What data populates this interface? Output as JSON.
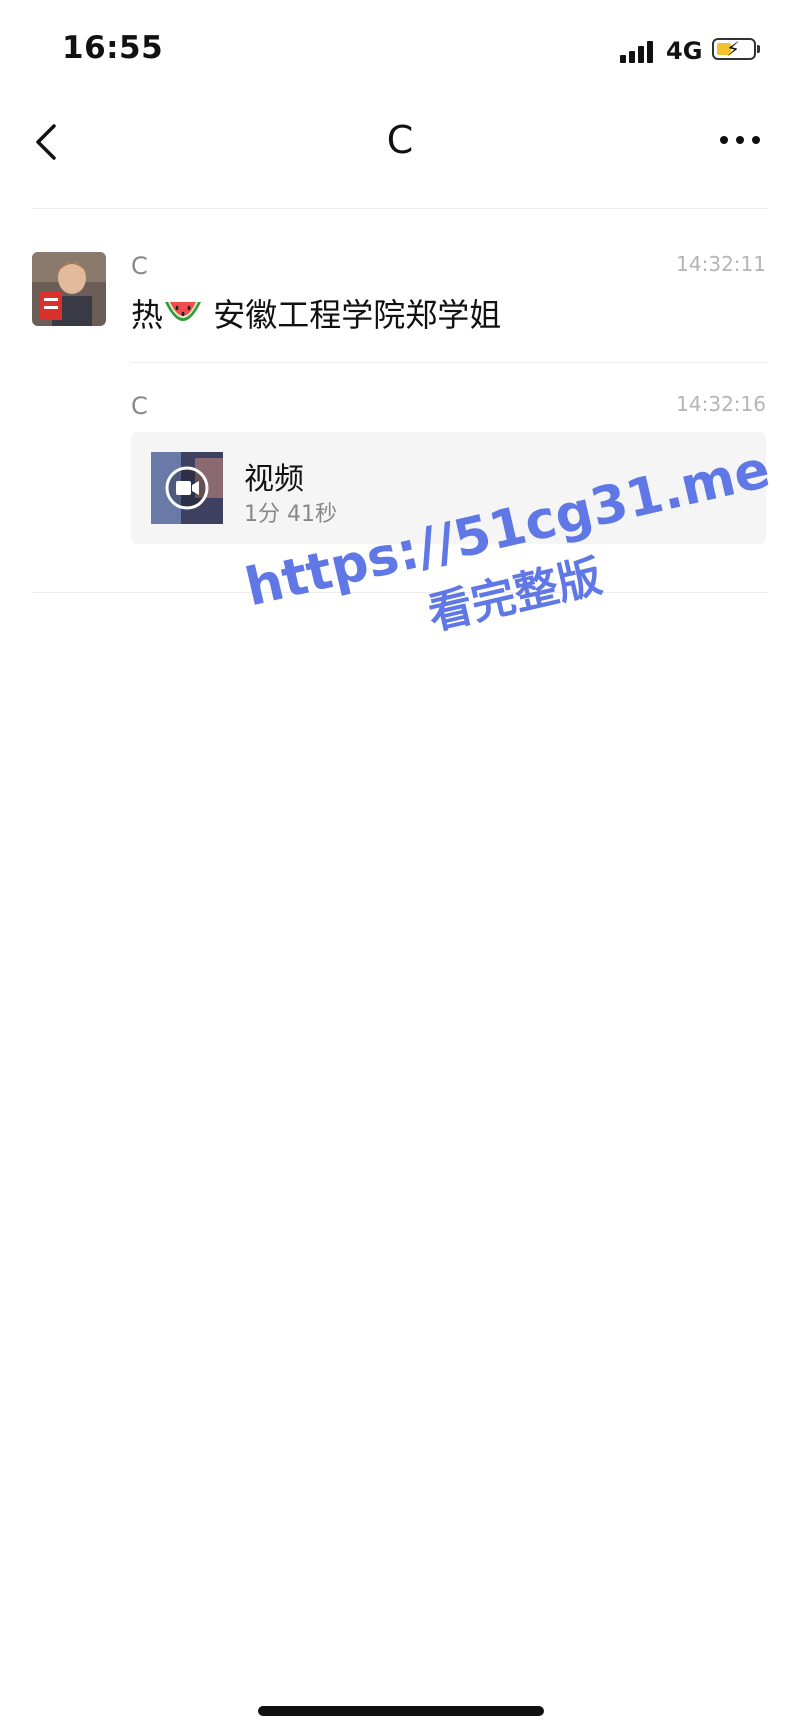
{
  "status_bar": {
    "time": "16:55",
    "network": "4G",
    "icons": [
      "signal-icon",
      "battery-charging-icon"
    ],
    "battery_color": "#f2c12e"
  },
  "nav": {
    "title": "C",
    "back_icon": "chevron-left-icon",
    "more_icon": "more-icon"
  },
  "messages": [
    {
      "sender": "C",
      "time": "14:32:11",
      "text_before": "热",
      "emoji_icon": "watermelon-icon",
      "text_after": " 安徽工程学院郑学姐"
    },
    {
      "sender": "C",
      "time": "14:32:16",
      "video": {
        "title": "视频",
        "duration": "1分 41秒",
        "icon": "video-camera-icon"
      }
    }
  ],
  "watermark": {
    "line1": "https://51cg31.me",
    "line2": "看完整版",
    "color": "#5f78e6"
  }
}
